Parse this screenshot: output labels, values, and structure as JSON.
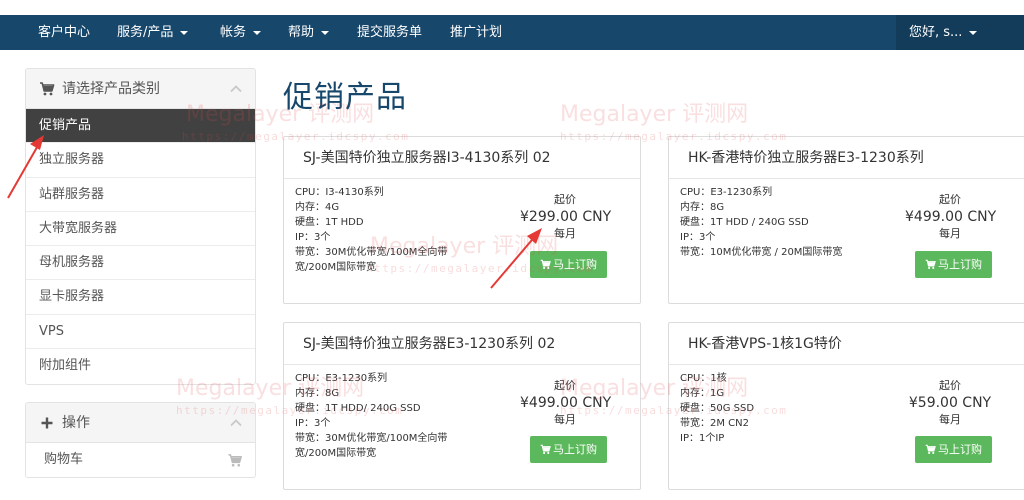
{
  "nav": {
    "items": [
      {
        "label": "客户中心"
      },
      {
        "label": "服务/产品"
      },
      {
        "label": "帐务"
      },
      {
        "label": "帮助"
      },
      {
        "label": "提交服务单"
      },
      {
        "label": "推广计划"
      }
    ],
    "greeting": "您好, s..."
  },
  "sidebar": {
    "categories_title": "请选择产品类别",
    "categories": [
      {
        "label": "促销产品",
        "active": true
      },
      {
        "label": "独立服务器"
      },
      {
        "label": "站群服务器"
      },
      {
        "label": "大带宽服务器"
      },
      {
        "label": "母机服务器"
      },
      {
        "label": "显卡服务器"
      },
      {
        "label": "VPS"
      },
      {
        "label": "附加组件"
      }
    ],
    "actions_title": "操作",
    "actions": [
      {
        "label": "购物车"
      }
    ]
  },
  "main": {
    "title": "促销产品",
    "price_from_label": "起价",
    "cycle_label": "每月",
    "order_label": "马上订购",
    "products": [
      {
        "name": "SJ-美国特价独立服务器I3-4130系列 02",
        "specs": [
          "CPU：I3-4130系列",
          "内存：4G",
          "硬盘：1T HDD",
          "IP：3个",
          "带宽：30M优化带宽/100M全向带宽/200M国际带宽"
        ],
        "price": "¥299.00 CNY"
      },
      {
        "name": "HK-香港特价独立服务器E3-1230系列",
        "specs": [
          "CPU：E3-1230系列",
          "内存：8G",
          "硬盘：1T HDD / 240G SSD",
          "IP：3个",
          "带宽：10M优化带宽 / 20M国际带宽"
        ],
        "price": "¥499.00 CNY"
      },
      {
        "name": "SJ-美国特价独立服务器E3-1230系列 02",
        "specs": [
          "CPU：E3-1230系列",
          "内存：8G",
          "硬盘：1T HDD/ 240G SSD",
          "IP：3个",
          "带宽：30M优化带宽/100M全向带宽/200M国际带宽"
        ],
        "price": "¥499.00 CNY"
      },
      {
        "name": "HK-香港VPS-1核1G特价",
        "specs": [
          "CPU：1核",
          "内存：1G",
          "硬盘：50G SSD",
          "带宽：2M CN2",
          "IP：1个IP"
        ],
        "price": "¥59.00 CNY"
      }
    ]
  },
  "watermark": {
    "brand": "Megalayer 评测网",
    "url": "https://megalayer.idcspy.com"
  },
  "colors": {
    "nav_bg": "#17476b",
    "active_item_bg": "#414141",
    "order_button": "#5cb85c",
    "title": "#17476b",
    "annotation_arrow": "#e53935"
  }
}
